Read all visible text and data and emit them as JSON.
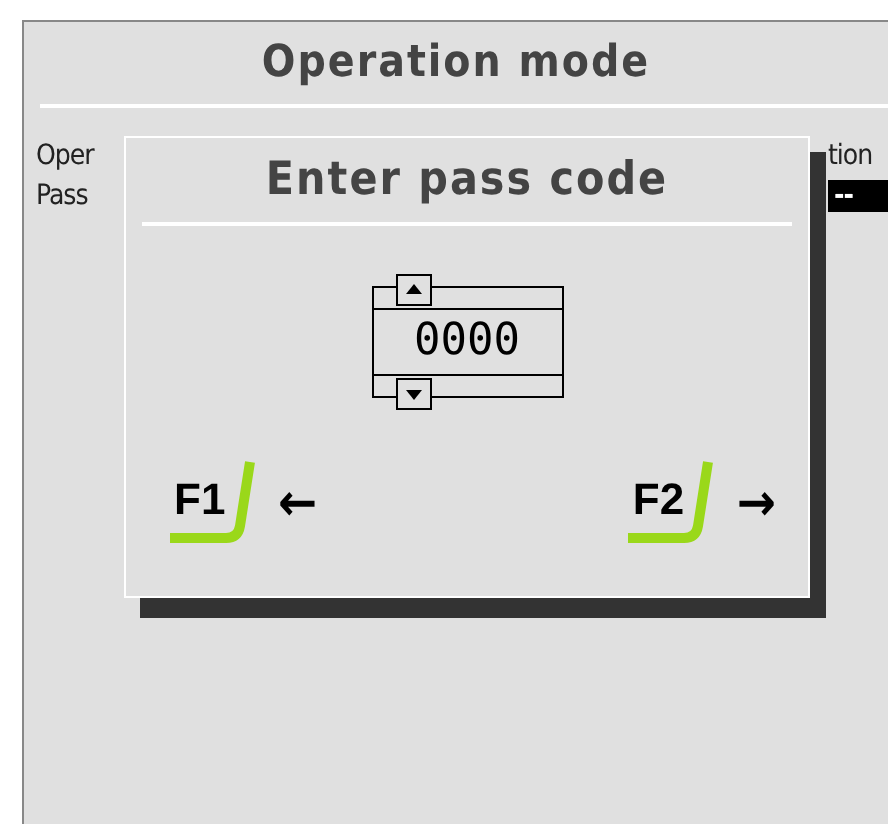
{
  "screen": {
    "title": "Operation mode",
    "rows": [
      {
        "label": "Oper",
        "value": "tion",
        "kind": "text"
      },
      {
        "label": "Pass",
        "value": "--",
        "kind": "field"
      }
    ]
  },
  "dialog": {
    "title": "Enter pass code",
    "code": "0000",
    "keys": [
      {
        "key": "F1",
        "arrow": "←"
      },
      {
        "key": "F2",
        "arrow": "→"
      }
    ]
  }
}
